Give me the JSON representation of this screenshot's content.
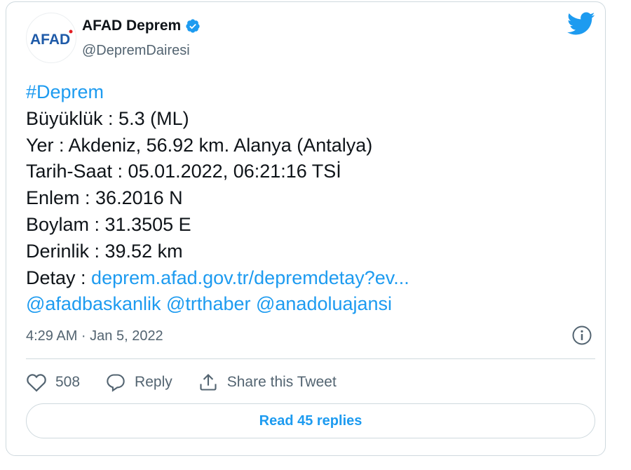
{
  "account": {
    "avatar_text": "AFAD",
    "display_name": "AFAD Deprem",
    "handle": "@DepremDairesi"
  },
  "colors": {
    "accent": "#1d9bf0",
    "afad_blue": "#1e5aa8",
    "afad_red": "#e31e24"
  },
  "icons": {
    "logo": "twitter-bird-icon",
    "verified": "verified-badge-icon",
    "info": "info-icon",
    "like": "heart-icon",
    "reply": "reply-bubble-icon",
    "share": "share-arrow-icon"
  },
  "tweet": {
    "hashtag": "#Deprem",
    "magnitude": "Büyüklük : 5.3 (ML)",
    "location": "Yer : Akdeniz, 56.92 km. Alanya (Antalya)",
    "datetime": "Tarih-Saat : 05.01.2022, 06:21:16 TSİ",
    "latitude": "Enlem : 36.2016 N",
    "longitude": "Boylam : 31.3505 E",
    "depth": "Derinlik : 39.52 km",
    "detail_label": "Detay : ",
    "detail_link": "deprem.afad.gov.tr/depremdetay?ev...",
    "mentions": "@afadbaskanlik @trthaber @anadoluajansi"
  },
  "timestamp": "4:29 AM · Jan 5, 2022",
  "actions": {
    "like_count": "508",
    "reply_label": "Reply",
    "share_label": "Share this Tweet"
  },
  "read_replies_label": "Read 45 replies"
}
